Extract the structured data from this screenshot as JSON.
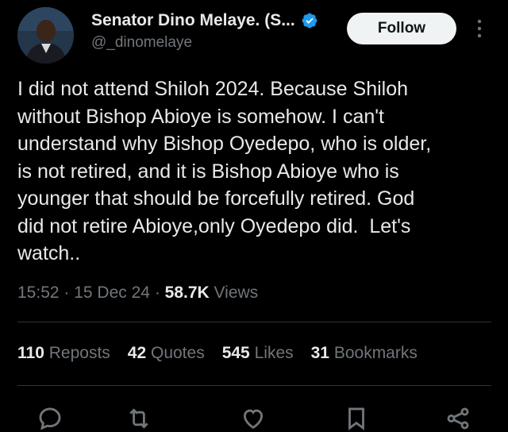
{
  "author": {
    "display_name": "Senator Dino Melaye. (S...",
    "handle": "@_dinomelaye",
    "verified_icon": "verified-badge-icon",
    "avatar_icon": "profile-avatar"
  },
  "follow_label": "Follow",
  "tweet_text": "I did not attend Shiloh 2024. Because Shiloh\nwithout Bishop Abioye is somehow. I can't\nunderstand why Bishop Oyedepo, who is older,\nis not retired, and it is Bishop Abioye who is\nyounger that should be forcefully retired. God\ndid not retire Abioye,only Oyedepo did.  Let's\nwatch..",
  "meta": {
    "time": "15:52",
    "date": "15 Dec 24",
    "views_count": "58.7K",
    "views_label": "Views"
  },
  "stats": [
    {
      "count": "110",
      "label": "Reposts"
    },
    {
      "count": "42",
      "label": "Quotes"
    },
    {
      "count": "545",
      "label": "Likes"
    },
    {
      "count": "31",
      "label": "Bookmarks"
    }
  ],
  "actions": [
    "reply-icon",
    "repost-icon",
    "like-icon",
    "bookmark-icon",
    "share-icon"
  ],
  "colors": {
    "background": "#000000",
    "text": "#e7e9ea",
    "muted": "#71767b",
    "verified": "#1d9bf0",
    "divider": "#2f3336",
    "follow_bg": "#eff3f4"
  }
}
